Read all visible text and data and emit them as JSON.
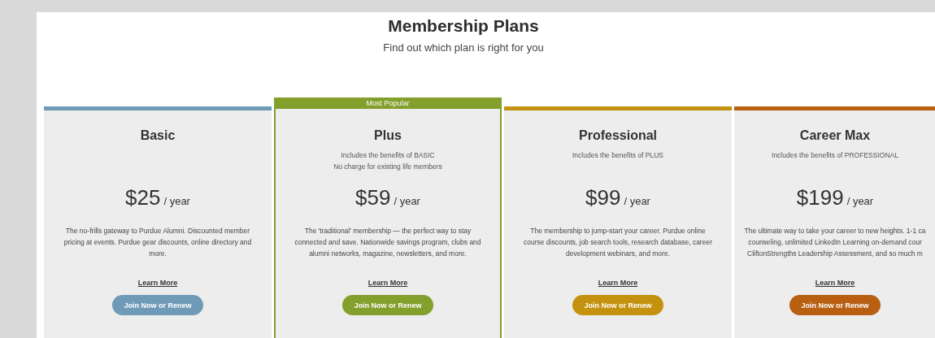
{
  "heading": {
    "title": "Membership Plans",
    "subtitle": "Find out which plan is right for you"
  },
  "plans": [
    {
      "name": "Basic",
      "featured": false,
      "color": "#6f9ab8",
      "price": "$25",
      "period": "/ year",
      "description": [
        "The no-frills gateway to Purdue Alumni. Discounted member",
        "pricing at events. Purdue gear discounts, online directory and",
        "more."
      ],
      "link": "Learn More",
      "button": "Join Now or Renew"
    },
    {
      "name": "Plus",
      "featured": true,
      "badge": "Most Popular",
      "color": "#839f2c",
      "benefits": [
        "Includes the benefits of BASIC",
        "No charge for existing life members"
      ],
      "price": "$59",
      "period": "/ year",
      "description": [
        "The 'traditional' membership — the perfect way to stay",
        "connected and save. Nationwide savings program, clubs and",
        "alumni networks, magazine, newsletters, and more."
      ],
      "link": "Learn More",
      "button": "Join Now or Renew"
    },
    {
      "name": "Professional",
      "featured": false,
      "color": "#c4920f",
      "benefits": [
        "Includes the benefits of PLUS"
      ],
      "price": "$99",
      "period": "/ year",
      "description": [
        "The membership to jump-start your career. Purdue online",
        "course discounts, job search tools, research database, career",
        "development webinars, and more."
      ],
      "link": "Learn More",
      "button": "Join Now or Renew"
    },
    {
      "name": "Career Max",
      "featured": false,
      "color": "#b85f12",
      "benefits": [
        "Includes the benefits of PROFESSIONAL"
      ],
      "price": "$199",
      "period": "/ year",
      "description": [
        "The ultimate way to take your career to new heights. 1-1 ca",
        "counseling, unlimited LinkedIn Learning on-demand cour",
        "CliftonStrengths Leadership Assessment, and so much m"
      ],
      "link": "Learn More",
      "button": "Join Now or Renew"
    }
  ]
}
